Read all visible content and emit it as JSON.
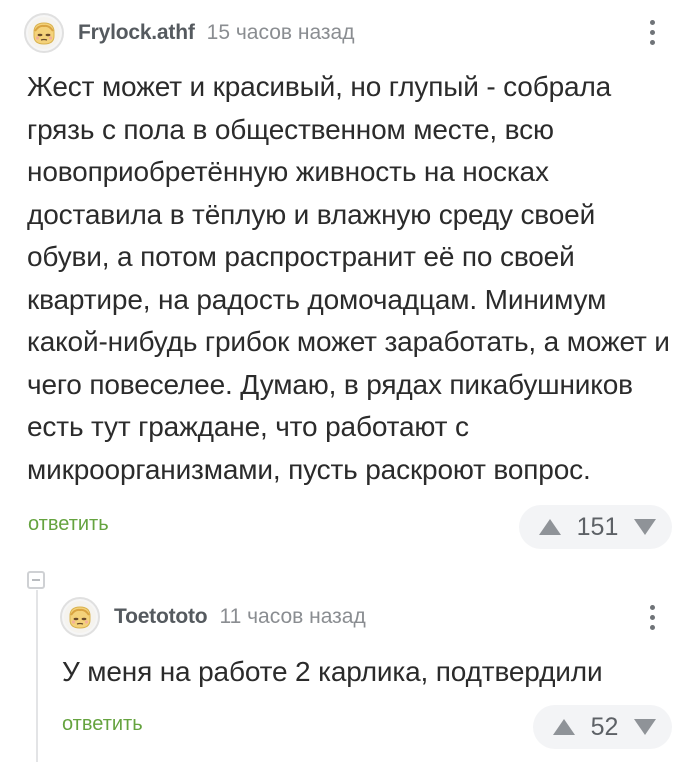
{
  "comment": {
    "username": "Frylock.athf",
    "timestamp": "15 часов назад",
    "text": "Жест может и красивый, но глупый - собрала грязь с пола в общественном месте, всю новоприобретённую живность на носках доставила в тёплую и влажную среду своей обуви, а потом распространит её по своей квартире, на радость домочадцам. Минимум какой-нибудь грибок может заработать, а может и чего повеселее. Думаю, в рядах пикабушников есть тут граждане, что работают с микроорганизмами, пусть раскроют вопрос.",
    "reply_label": "ответить",
    "rating": "151",
    "avatar_icon": "default-avatar-icon"
  },
  "reply": {
    "username": "Toetototo",
    "timestamp": "11 часов назад",
    "text": "У меня на работе 2 карлика, подтвердили",
    "reply_label": "ответить",
    "rating": "52",
    "avatar_icon": "default-avatar-icon"
  },
  "colors": {
    "accent": "#65a33f",
    "username": "#555a5f",
    "meta": "#8a8d91",
    "vote_bg": "#f3f4f6",
    "vote_arrow": "#8f9398",
    "thread_line": "#e3e4e6"
  },
  "icons": {
    "upvote": "triangle-up-icon",
    "downvote": "triangle-down-icon",
    "more": "more-vertical-icon",
    "collapse": "minus-square-icon"
  }
}
